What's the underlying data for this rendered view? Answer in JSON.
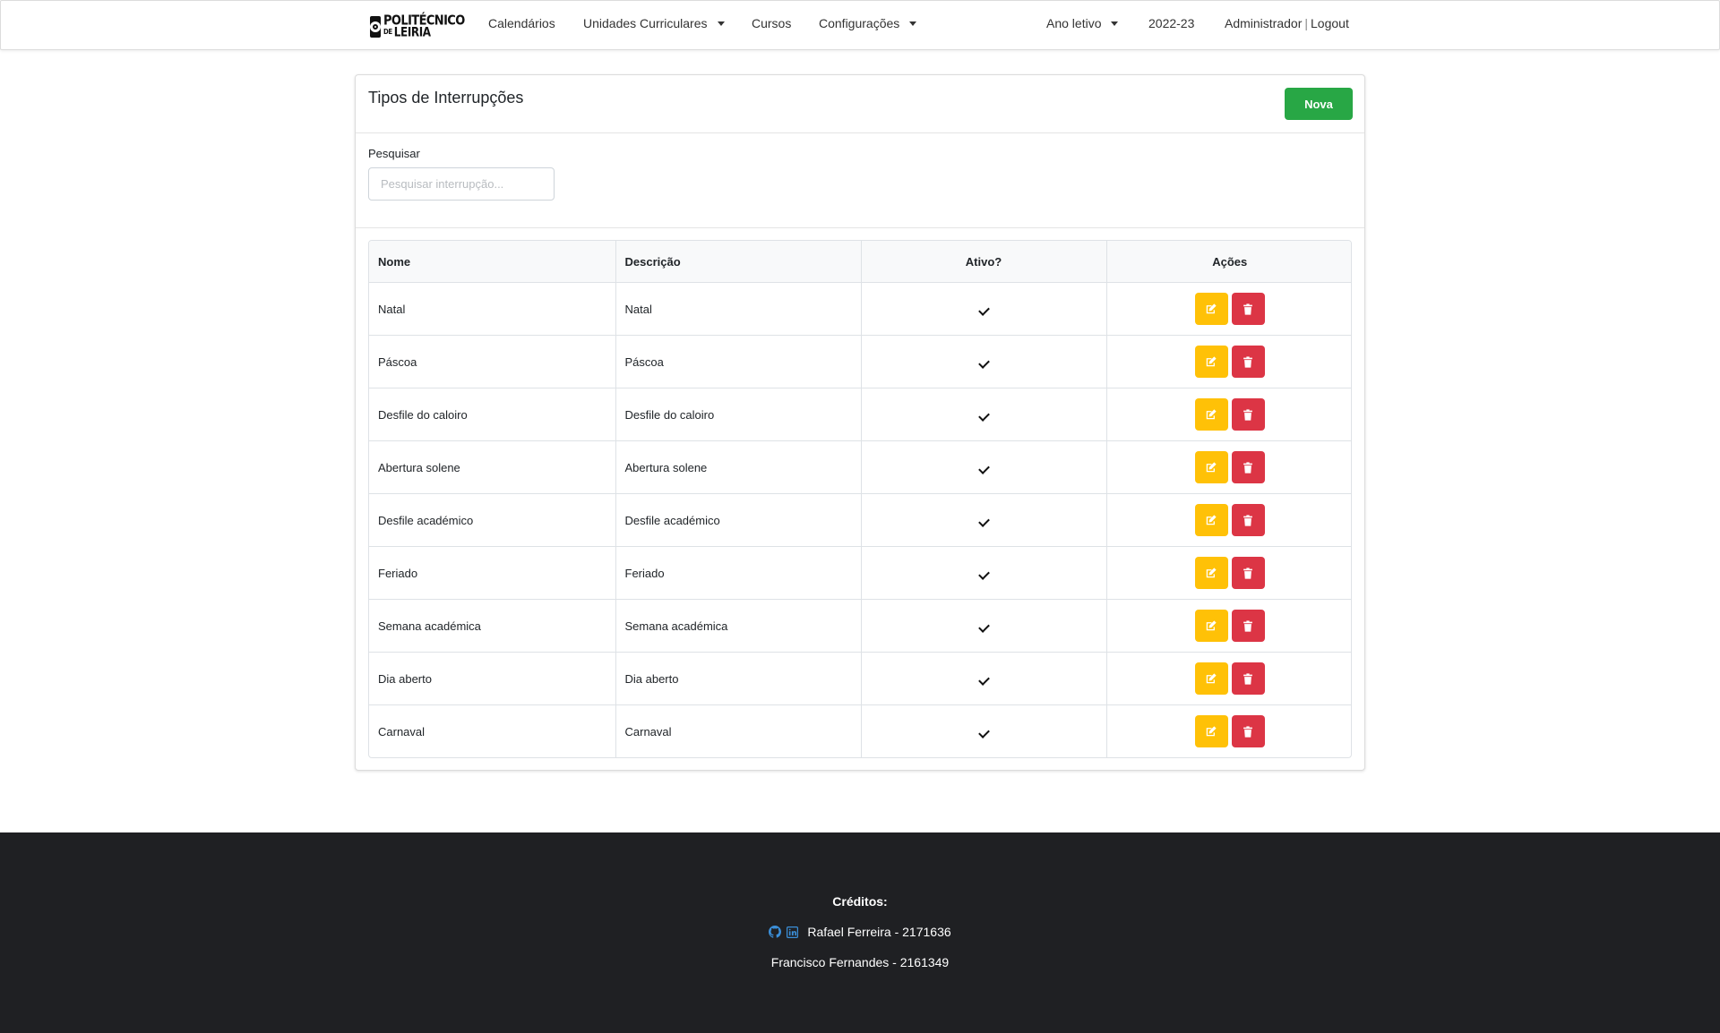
{
  "navbar": {
    "logo": {
      "line1": "POLITÉCNICO",
      "line2_prefix": "DE",
      "line2": "LEIRIA"
    },
    "links": [
      {
        "label": "Calendários"
      },
      {
        "label": "Unidades Curriculares"
      },
      {
        "label": "Cursos"
      },
      {
        "label": "Configurações"
      }
    ],
    "right": {
      "year_dropdown": "Ano letivo",
      "year_value": "2022-23",
      "user": "Administrador",
      "separator": "|",
      "logout": "Logout"
    }
  },
  "page": {
    "title": "Tipos de Interrupções",
    "new_button": "Nova",
    "search": {
      "label": "Pesquisar",
      "placeholder": "Pesquisar interrupção...",
      "value": ""
    }
  },
  "table": {
    "columns": [
      "Nome",
      "Descrição",
      "Ativo?",
      "Ações"
    ],
    "rows": [
      {
        "nome": "Natal",
        "descricao": "Natal",
        "ativo": true
      },
      {
        "nome": "Páscoa",
        "descricao": "Páscoa",
        "ativo": true
      },
      {
        "nome": "Desfile do caloiro",
        "descricao": "Desfile do caloiro",
        "ativo": true
      },
      {
        "nome": "Abertura solene",
        "descricao": "Abertura solene",
        "ativo": true
      },
      {
        "nome": "Desfile académico",
        "descricao": "Desfile académico",
        "ativo": true
      },
      {
        "nome": "Feriado",
        "descricao": "Feriado",
        "ativo": true
      },
      {
        "nome": "Semana académica",
        "descricao": "Semana académica",
        "ativo": true
      },
      {
        "nome": "Dia aberto",
        "descricao": "Dia aberto",
        "ativo": true
      },
      {
        "nome": "Carnaval",
        "descricao": "Carnaval",
        "ativo": true
      }
    ],
    "action_icons": {
      "edit": "edit-icon",
      "delete": "trash-icon"
    }
  },
  "footer": {
    "title": "Créditos:",
    "credit1": "Rafael Ferreira - 2171636",
    "credit1_icons": [
      "github-icon",
      "linkedin-icon"
    ],
    "credit2": "Francisco Fernandes - 2161349"
  },
  "colors": {
    "new_button": "#28a745",
    "edit_button": "#ffc107",
    "delete_button": "#dc3545",
    "footer_bg": "#1f2023",
    "footer_icon": "#3b8fd9"
  }
}
